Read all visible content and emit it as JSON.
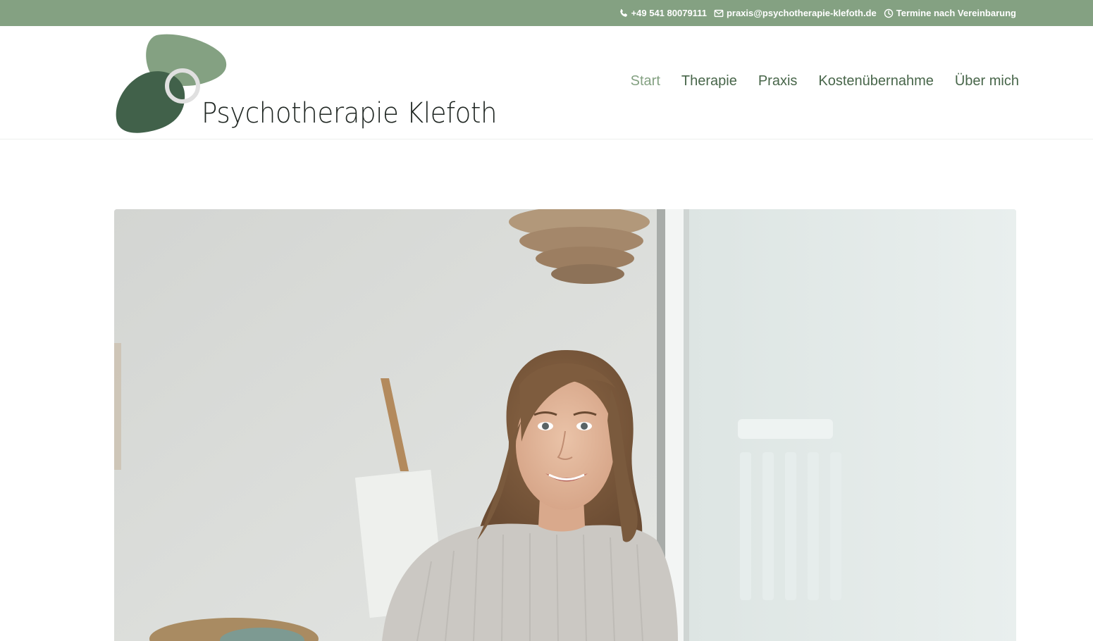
{
  "topbar": {
    "phone": "+49 541 80079111",
    "email": "praxis@psychotherapie-klefoth.de",
    "hours": "Termine nach Vereinbarung",
    "background_color": "#84a182",
    "icons": [
      "phone-icon",
      "mail-icon",
      "clock-icon"
    ]
  },
  "brand": {
    "name": "Psychotherapie Klefoth",
    "logo_colors": [
      "#84a182",
      "#41614a",
      "#e0e0e0"
    ]
  },
  "nav": {
    "items": [
      {
        "label": "Start",
        "active": true
      },
      {
        "label": "Therapie",
        "active": false
      },
      {
        "label": "Praxis",
        "active": false
      },
      {
        "label": "Kostenübernahme",
        "active": false
      },
      {
        "label": "Über mich",
        "active": false
      }
    ],
    "color": "#48664a",
    "active_color": "#84a182"
  },
  "hero": {
    "image_subject": "portrait-photo"
  }
}
